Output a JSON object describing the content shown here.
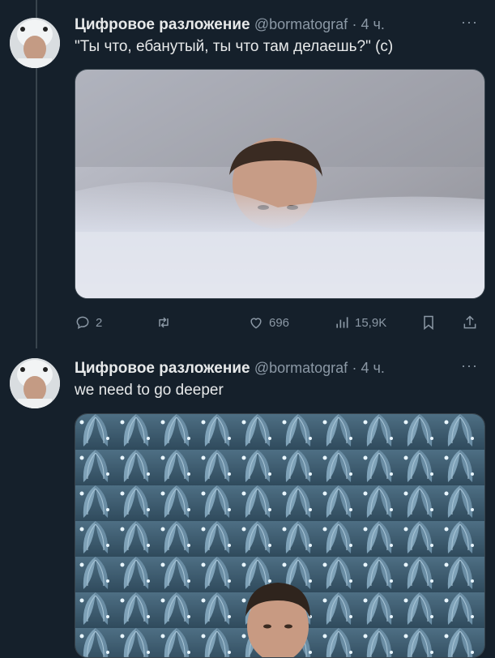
{
  "tweets": [
    {
      "author_name": "Цифровое разложение",
      "handle": "@bormatograf",
      "time": "· 4 ч.",
      "more": "···",
      "text": "\"Ты что, ебанутый, ты что там делаешь?\" (с)",
      "media_icon": "photo-face-peeking-over-blurred-foreground",
      "actions": {
        "reply_count": "2",
        "retweet_count": "",
        "like_count": "696",
        "views_count": "15,9K"
      }
    },
    {
      "author_name": "Цифровое разложение",
      "handle": "@bormatograf",
      "time": "· 4 ч.",
      "more": "···",
      "text": "we need to go deeper",
      "media_icon": "photo-face-below-knitted-fabric"
    }
  ],
  "colors": {
    "background": "#15202b",
    "text": "#e7e9ea",
    "secondary": "#8b98a5",
    "divider": "#38444d"
  }
}
